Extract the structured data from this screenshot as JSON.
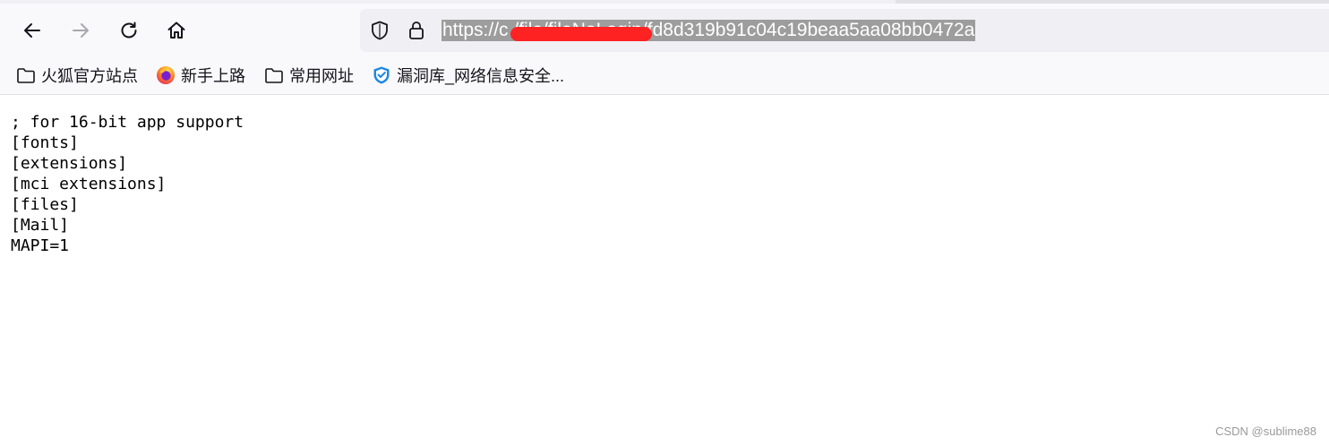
{
  "toolbar": {
    "back_icon": "arrow-left-icon",
    "forward_icon": "arrow-right-icon",
    "reload_icon": "reload-icon",
    "home_icon": "home-icon"
  },
  "urlbar": {
    "url": "https://c[redacted]/file/fileNoLogin/fd8d319b91c04c19beaa5aa08bb0472a",
    "url_visible": "https://c                    /file/fileNoLogin/fd8d319b91c04c19beaa5aa08bb0472a",
    "shield_icon": "shield-icon",
    "lock_icon": "lock-icon",
    "selection_color": "#9d9d9d",
    "redaction_color": "#ff2222"
  },
  "bookmarks": [
    {
      "label": "火狐官方站点",
      "icon": "folder-icon"
    },
    {
      "label": "新手上路",
      "icon": "firefox-icon"
    },
    {
      "label": "常用网址",
      "icon": "folder-icon"
    },
    {
      "label": "漏洞库_网络信息安全...",
      "icon": "shield-check-icon"
    }
  ],
  "content": {
    "lines": [
      "; for 16-bit app support",
      "[fonts]",
      "[extensions]",
      "[mci extensions]",
      "[files]",
      "[Mail]",
      "MAPI=1"
    ]
  },
  "watermark": "CSDN @sublime88"
}
